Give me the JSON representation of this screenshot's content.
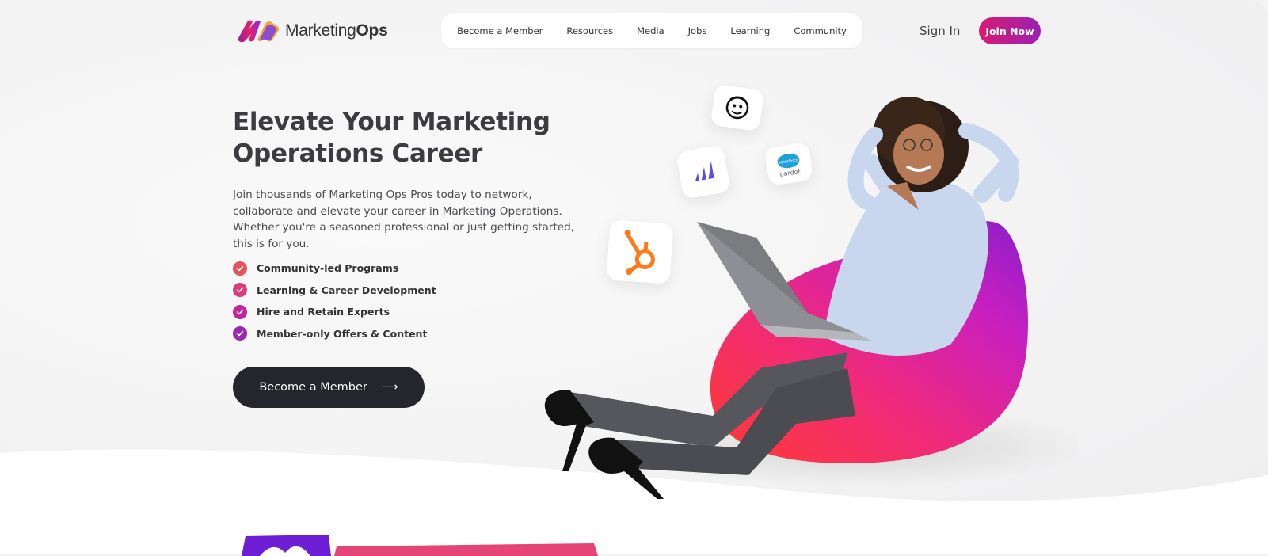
{
  "brand": {
    "logo_text_regular": "Marketing",
    "logo_text_bold": "Ops",
    "colors": {
      "pink": "#e91e63",
      "magenta": "#c2189f",
      "purple": "#8e24aa",
      "dark": "#25262b"
    }
  },
  "nav": {
    "items": [
      {
        "label": "Become a Member"
      },
      {
        "label": "Resources"
      },
      {
        "label": "Media"
      },
      {
        "label": "Jobs"
      },
      {
        "label": "Learning"
      },
      {
        "label": "Community"
      }
    ],
    "sign_in": "Sign In",
    "join_now": "Join Now"
  },
  "hero": {
    "title": "Elevate Your Marketing Operations Career",
    "description": "Join thousands of Marketing Ops Pros today to network, collaborate and elevate your career in Marketing Operations. Whether you're a seasoned professional or just getting started, this is for you.",
    "features": [
      {
        "label": "Community-led Programs",
        "color": "#e8505b"
      },
      {
        "label": "Learning & Career Development",
        "color": "#dc3b7a"
      },
      {
        "label": "Hire and Retain Experts",
        "color": "#c2249a"
      },
      {
        "label": "Member-only Offers & Content",
        "color": "#9c27b0"
      }
    ],
    "cta_label": "Become a Member",
    "cta_arrow": "⟶"
  },
  "tool_icons": [
    {
      "icon": "mailchimp-icon"
    },
    {
      "icon": "marketo-icon"
    },
    {
      "icon": "salesforce-pardot-icon",
      "text_top": "salesforce",
      "text_bottom": "pardot"
    },
    {
      "icon": "hubspot-icon"
    }
  ]
}
